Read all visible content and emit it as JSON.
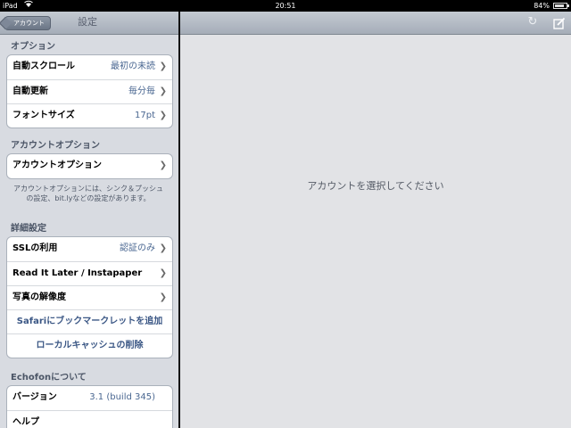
{
  "status_bar": {
    "carrier": "iPad",
    "wifi_icon": "wifi-icon",
    "time": "20:51",
    "battery": "84%",
    "battery_level": 0.84
  },
  "master": {
    "back_button": "アカウント",
    "title": "設定",
    "sections": [
      {
        "header": "オプション",
        "rows": [
          {
            "label": "自動スクロール",
            "value": "最初の未読"
          },
          {
            "label": "自動更新",
            "value": "毎分毎"
          },
          {
            "label": "フォントサイズ",
            "value": "17pt"
          }
        ]
      },
      {
        "header": "アカウントオプション",
        "rows": [
          {
            "label": "アカウントオプション",
            "value": ""
          }
        ],
        "footnote": "アカウントオプションには、シンク＆プッシュの設定、bit.lyなどの設定があります。"
      },
      {
        "header": "詳細設定",
        "rows": [
          {
            "label": "SSLの利用",
            "value": "認証のみ"
          },
          {
            "label": "Read It Later / Instapaper",
            "value": ""
          },
          {
            "label": "写真の解像度",
            "value": ""
          },
          {
            "label": "Safariにブックマークレットを追加",
            "value": ""
          },
          {
            "label": "ローカルキャッシュの削除",
            "value": ""
          }
        ]
      },
      {
        "header": "Echofonについて",
        "rows": [
          {
            "label": "バージョン",
            "value": "3.1 (build 345)"
          },
          {
            "label": "ヘルプ",
            "value": ""
          }
        ]
      }
    ]
  },
  "detail": {
    "message": "アカウントを選択してください",
    "refresh_icon": "refresh-icon",
    "compose_icon": "compose-icon"
  }
}
